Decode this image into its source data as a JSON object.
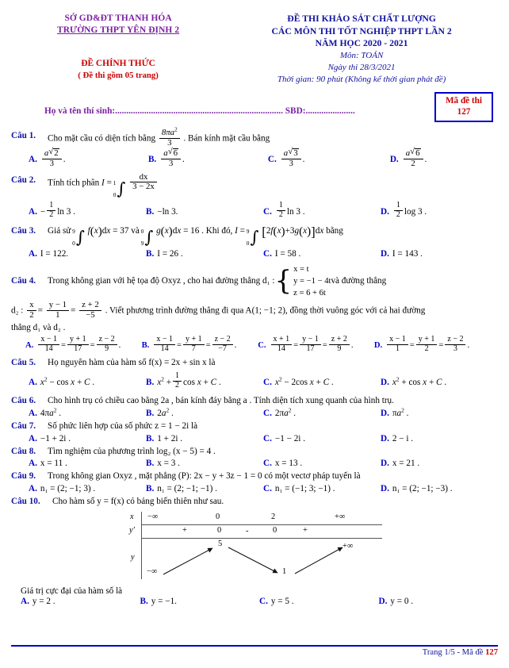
{
  "header": {
    "school_line1": "SỞ GD&ĐT THANH HÓA",
    "school_line2": "TRƯỜNG THPT YÊN ĐỊNH 2",
    "official_label": "ĐỀ CHÍNH THỨC",
    "official_sub": "( Đề thi gồm 05 trang)",
    "exam_title_line1": "ĐỀ THI KHẢO SÁT CHẤT LƯỢNG",
    "exam_title_line2": "CÁC MÔN THI TỐT NGHIỆP THPT LẦN 2",
    "exam_title_line3": "NĂM HỌC 2020 - 2021",
    "subject": "Môn: TOÁN",
    "exam_date": "Ngày thi 28/3/2021",
    "duration": "Thời gian: 90 phút (Không kể thời gian phát đề)"
  },
  "candidate": {
    "line": "Họ và tên thí sinh:........................................................................... SBD:......................",
    "code_label": "Mã đề thi",
    "code_value": "127"
  },
  "questions": {
    "q1": {
      "label": "Câu 1.",
      "text_before": "Cho mặt cầu có diện tích bằng",
      "area_num": "8πa²",
      "area_den": "3",
      "text_after": ". Bán kính mặt cầu bằng",
      "options": [
        {
          "letter": "A.",
          "num": "a√2",
          "den": "3"
        },
        {
          "letter": "B.",
          "num": "a√6",
          "den": "3"
        },
        {
          "letter": "C.",
          "num": "a√3",
          "den": "3"
        },
        {
          "letter": "D.",
          "num": "a√6",
          "den": "2"
        }
      ]
    },
    "q2": {
      "label": "Câu 2.",
      "text": "Tính tích phân",
      "integral_upper": "1",
      "integral_lower": "0",
      "integrand_num": "dx",
      "integrand_den": "3 − 2x",
      "options": [
        {
          "letter": "A.",
          "value": "−(1/2) ln 3 ."
        },
        {
          "letter": "B.",
          "value": "−ln 3 ."
        },
        {
          "letter": "C.",
          "value": "(1/2) ln 3 ."
        },
        {
          "letter": "D.",
          "value": "(1/2) log 3 ."
        }
      ]
    },
    "q3": {
      "label": "Câu 3.",
      "text_a": "Giả sử",
      "int1_upper": "9",
      "int1_lower": "0",
      "int1_body": "f(x)dx = 37",
      "text_b": "và",
      "int2_upper": "0",
      "int2_lower": "9",
      "int2_body": "g(x)dx = 16",
      "text_c": ". Khi đó,",
      "int3_upper": "9",
      "int3_lower": "0",
      "int3_body": "[2f(x) + 3g(x)]dx",
      "text_d": "bằng",
      "options": [
        {
          "letter": "A.",
          "value": "I = 122."
        },
        {
          "letter": "B.",
          "value": "I = 26 ."
        },
        {
          "letter": "C.",
          "value": "I = 58 ."
        },
        {
          "letter": "D.",
          "value": "I = 143 ."
        }
      ]
    },
    "q4": {
      "label": "Câu 4.",
      "text_a": "Trong không gian với hệ tọa độ Oxyz , cho hai đường thẳng",
      "d1_name": "d₁ :",
      "d1_rows": [
        "x = t",
        "y = −1 − 4t",
        "z = 6 + 6t"
      ],
      "text_b": "và đường thẳng",
      "d2_label": "d₂ :",
      "d2_f1_num": "x",
      "d2_f1_den": "2",
      "d2_f2_num": "y − 1",
      "d2_f2_den": "1",
      "d2_f3_num": "z + 2",
      "d2_f3_den": "−5",
      "text_c": ". Viết phương trình đường thẳng đi qua  A(1; −1; 2), đồng thời vuông góc với cả hai đường",
      "text_d": "thẳng d₁ và d₂ .",
      "options": [
        {
          "letter": "A.",
          "n1": "x − 1",
          "d1": "14",
          "n2": "y + 1",
          "d2": "17",
          "n3": "z − 2",
          "d3": "9",
          "tail": "."
        },
        {
          "letter": "B.",
          "n1": "x − 1",
          "d1": "14",
          "n2": "y + 1",
          "d2": "7",
          "n3": "z − 2",
          "d3": "−7",
          "tail": "."
        },
        {
          "letter": "C.",
          "n1": "x + 1",
          "d1": "14",
          "n2": "y − 1",
          "d2": "17",
          "n3": "z + 2",
          "d3": "9",
          "tail": "."
        },
        {
          "letter": "D.",
          "n1": "x − 1",
          "d1": "1",
          "n2": "y + 1",
          "d2": "2",
          "n3": "z − 2",
          "d3": "3",
          "tail": "."
        }
      ]
    },
    "q5": {
      "label": "Câu 5.",
      "text": "Họ nguyên hàm của hàm số  f(x) = 2x + sin x  là",
      "options": [
        {
          "letter": "A.",
          "value": "x² − cos x + C ."
        },
        {
          "letter": "B.",
          "value": "x² + (1/2) cos x + C ."
        },
        {
          "letter": "C.",
          "value": "x² − 2cos x + C ."
        },
        {
          "letter": "D.",
          "value": "x² + cos x + C ."
        }
      ]
    },
    "q6": {
      "label": "Câu 6.",
      "text": "Cho hình trụ có chiều cao bằng 2a , bán kính đáy bằng a . Tính diện tích xung quanh của hình trụ.",
      "options": [
        {
          "letter": "A.",
          "value": "4πa² ."
        },
        {
          "letter": "B.",
          "value": "2a² ."
        },
        {
          "letter": "C.",
          "value": "2πa² ."
        },
        {
          "letter": "D.",
          "value": "πa² ."
        }
      ]
    },
    "q7": {
      "label": "Câu 7.",
      "text": "Số phức liên hợp của số phức  z = 1 − 2i  là",
      "options": [
        {
          "letter": "A.",
          "value": "−1 + 2i ."
        },
        {
          "letter": "B.",
          "value": "1 + 2i ."
        },
        {
          "letter": "C.",
          "value": "−1 − 2i ."
        },
        {
          "letter": "D.",
          "value": "2 − i ."
        }
      ]
    },
    "q8": {
      "label": "Câu 8.",
      "text": "Tìm nghiệm của phương trình log₂ (x − 5) = 4 .",
      "options": [
        {
          "letter": "A.",
          "value": "x = 11 ."
        },
        {
          "letter": "B.",
          "value": "x = 3 ."
        },
        {
          "letter": "C.",
          "value": "x = 13 ."
        },
        {
          "letter": "D.",
          "value": "x = 21 ."
        }
      ]
    },
    "q9": {
      "label": "Câu 9.",
      "text": "Trong không gian Oxyz , mặt phẳng (P): 2x − y + 3z − 1 = 0 có một vectơ pháp tuyến là",
      "options": [
        {
          "letter": "A.",
          "value": "n₁ = (2; −1; 3) ."
        },
        {
          "letter": "B.",
          "value": "n₁ = (2; −1; −1) ."
        },
        {
          "letter": "C.",
          "value": "n₁ = (−1; 3; −1) ."
        },
        {
          "letter": "D.",
          "value": "n₁ = (2; −1; −3) ."
        }
      ]
    },
    "q10": {
      "label": "Câu 10.",
      "text": "Cho hàm số  y = f(x) có bảng biến thiên như sau.",
      "question_tail": "Giá trị cực đại của hàm số là",
      "options": [
        {
          "letter": "A.",
          "value": "y = 2 ."
        },
        {
          "letter": "B.",
          "value": "y = −1."
        },
        {
          "letter": "C.",
          "value": "y = 5 ."
        },
        {
          "letter": "D.",
          "value": "y = 0 ."
        }
      ]
    }
  },
  "chart_data": {
    "type": "table",
    "title": "Bảng biến thiên",
    "row_labels": [
      "x",
      "y′",
      "y"
    ],
    "x_values": [
      "−∞",
      "0",
      "2",
      "+∞"
    ],
    "yprime_signs": [
      "+",
      "0",
      "-",
      "0",
      "+"
    ],
    "y_values": [
      "−∞",
      "5",
      "1",
      "+∞"
    ],
    "branches": [
      {
        "from": "−∞",
        "to": "5",
        "direction": "increasing"
      },
      {
        "from": "5",
        "to": "1",
        "direction": "decreasing"
      },
      {
        "from": "1",
        "to": "+∞",
        "direction": "increasing"
      }
    ]
  },
  "footer": {
    "page_text": "Trang 1/5 - Mã đề ",
    "code": "127"
  }
}
